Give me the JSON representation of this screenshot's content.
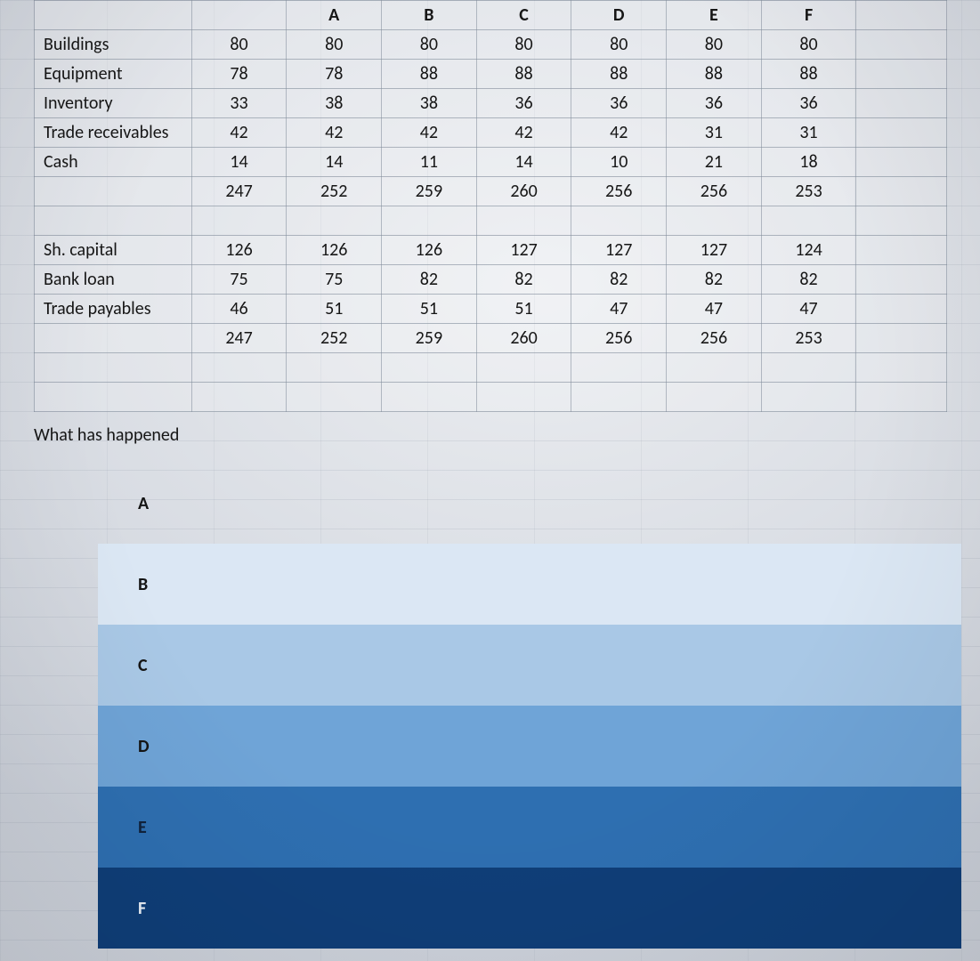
{
  "headers": [
    "",
    "",
    "A",
    "B",
    "C",
    "D",
    "E",
    "F"
  ],
  "assets": [
    {
      "label": "Buildings",
      "vals": [
        "80",
        "80",
        "80",
        "80",
        "80",
        "80",
        "80"
      ]
    },
    {
      "label": "Equipment",
      "vals": [
        "78",
        "78",
        "88",
        "88",
        "88",
        "88",
        "88"
      ]
    },
    {
      "label": "Inventory",
      "vals": [
        "33",
        "38",
        "38",
        "36",
        "36",
        "36",
        "36"
      ]
    },
    {
      "label": "Trade receivables",
      "vals": [
        "42",
        "42",
        "42",
        "42",
        "42",
        "31",
        "31"
      ]
    },
    {
      "label": "Cash",
      "vals": [
        "14",
        "14",
        "11",
        "14",
        "10",
        "21",
        "18"
      ]
    }
  ],
  "assets_total": [
    "247",
    "252",
    "259",
    "260",
    "256",
    "256",
    "253"
  ],
  "equity": [
    {
      "label": "Sh. capital",
      "vals": [
        "126",
        "126",
        "126",
        "127",
        "127",
        "127",
        "124"
      ]
    },
    {
      "label": "Bank loan",
      "vals": [
        "75",
        "75",
        "82",
        "82",
        "82",
        "82",
        "82"
      ]
    },
    {
      "label": "Trade payables",
      "vals": [
        "46",
        "51",
        "51",
        "51",
        "47",
        "47",
        "47"
      ]
    }
  ],
  "equity_total": [
    "247",
    "252",
    "259",
    "260",
    "256",
    "256",
    "253"
  ],
  "question": "What has happened",
  "bands": [
    "A",
    "B",
    "C",
    "D",
    "E",
    "F"
  ]
}
